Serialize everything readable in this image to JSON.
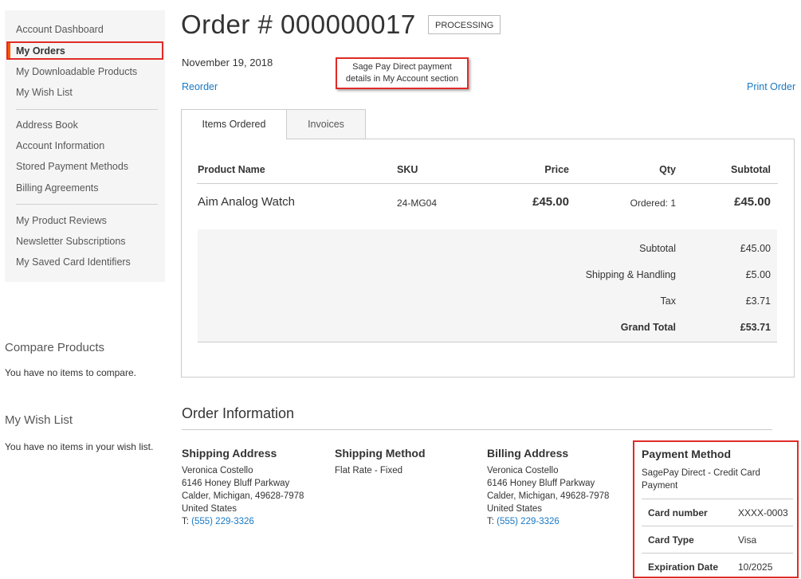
{
  "sidebar": {
    "items": [
      {
        "label": "Account Dashboard"
      },
      {
        "label": "My Orders"
      },
      {
        "label": "My Downloadable Products"
      },
      {
        "label": "My Wish List"
      },
      {
        "label": "Address Book"
      },
      {
        "label": "Account Information"
      },
      {
        "label": "Stored Payment Methods"
      },
      {
        "label": "Billing Agreements"
      },
      {
        "label": "My Product Reviews"
      },
      {
        "label": "Newsletter Subscriptions"
      },
      {
        "label": "My Saved Card Identifiers"
      }
    ]
  },
  "compare": {
    "title": "Compare Products",
    "text": "You have no items to compare."
  },
  "wishlist": {
    "title": "My Wish List",
    "text": "You have no items in your wish list."
  },
  "order": {
    "title": "Order # 000000017",
    "status": "PROCESSING",
    "date": "November 19, 2018",
    "reorder": "Reorder",
    "print": "Print Order"
  },
  "callout": {
    "line1": "Sage Pay Direct payment",
    "line2": "details in My Account section"
  },
  "tabs": [
    {
      "label": "Items Ordered"
    },
    {
      "label": "Invoices"
    }
  ],
  "items_table": {
    "headers": {
      "name": "Product Name",
      "sku": "SKU",
      "price": "Price",
      "qty": "Qty",
      "subtotal": "Subtotal"
    },
    "rows": [
      {
        "name": "Aim Analog Watch",
        "sku": "24-MG04",
        "price": "£45.00",
        "qty": "Ordered: 1",
        "subtotal": "£45.00"
      }
    ]
  },
  "totals": [
    {
      "label": "Subtotal",
      "value": "£45.00"
    },
    {
      "label": "Shipping & Handling",
      "value": "£5.00"
    },
    {
      "label": "Tax",
      "value": "£3.71"
    },
    {
      "label": "Grand Total",
      "value": "£53.71"
    }
  ],
  "order_info": {
    "title": "Order Information",
    "shipping_address": {
      "title": "Shipping Address",
      "name": "Veronica Costello",
      "street": "6146 Honey Bluff Parkway",
      "city": "Calder, Michigan, 49628-7978",
      "country": "United States",
      "phone_prefix": "T: ",
      "phone": "(555) 229-3326"
    },
    "shipping_method": {
      "title": "Shipping Method",
      "value": "Flat Rate - Fixed"
    },
    "billing_address": {
      "title": "Billing Address",
      "name": "Veronica Costello",
      "street": "6146 Honey Bluff Parkway",
      "city": "Calder, Michigan, 49628-7978",
      "country": "United States",
      "phone_prefix": "T: ",
      "phone": "(555) 229-3326"
    },
    "payment_method": {
      "title": "Payment Method",
      "description": "SagePay Direct - Credit Card Payment",
      "rows": [
        {
          "label": "Card number",
          "value": "XXXX-0003"
        },
        {
          "label": "Card Type",
          "value": "Visa"
        },
        {
          "label": "Expiration Date",
          "value": "10/2025"
        }
      ]
    }
  },
  "colors": {
    "accent": "#e02b27",
    "active_nav": "#ff5501",
    "link": "#1979c3"
  }
}
